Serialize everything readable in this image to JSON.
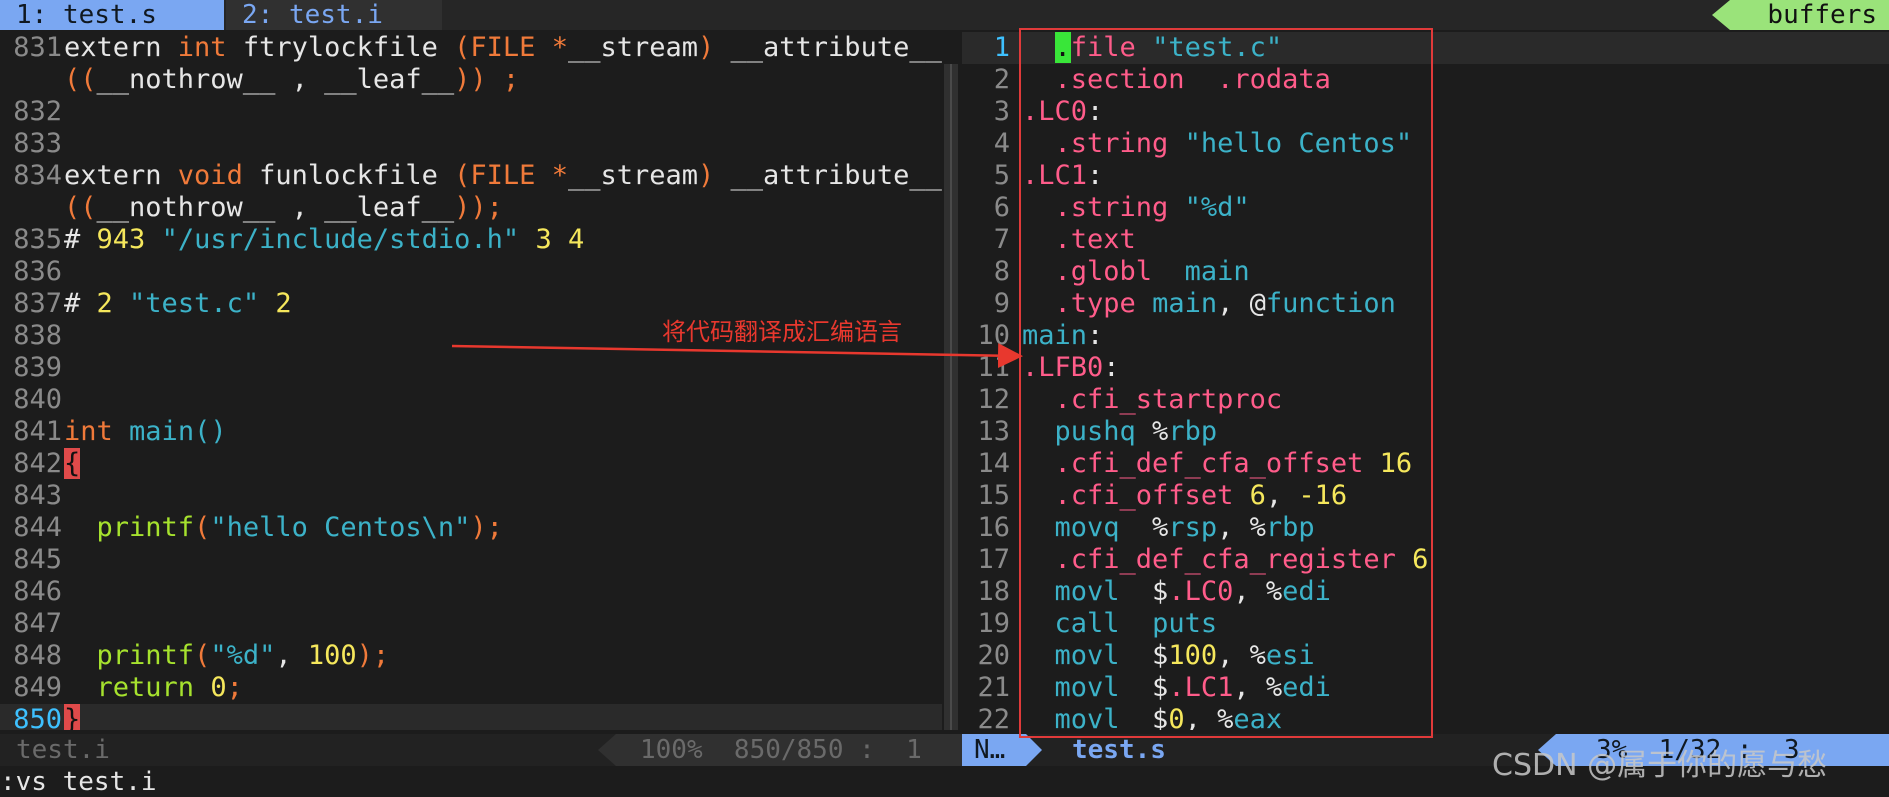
{
  "tabs": [
    {
      "label": "1: test.s"
    },
    {
      "label": "2: test.i"
    }
  ],
  "buffers_label": "buffers",
  "left_pane": {
    "lines": [
      {
        "num": "831",
        "html": "extern <span class=\"ty\">int</span> ftrylockfile <span class=\"kw\">(FILE *</span>__stream<span class=\"kw\">)</span> __attribute__"
      },
      {
        "num": "",
        "html": "<span class=\"kw\">((</span>__nothrow__ , __leaf__<span class=\"kw\">)) ;</span>"
      },
      {
        "num": "832",
        "html": ""
      },
      {
        "num": "833",
        "html": ""
      },
      {
        "num": "834",
        "html": "extern <span class=\"ty\">void</span> funlockfile <span class=\"kw\">(FILE *</span>__stream<span class=\"kw\">)</span> __attribute__"
      },
      {
        "num": "",
        "html": "<span class=\"kw\">((</span>__nothrow__ , __leaf__<span class=\"kw\">));</span>"
      },
      {
        "num": "835",
        "html": "# <span class=\"num\">943</span> <span class=\"str\">\"/usr/include/stdio.h\"</span> <span class=\"num\">3 4</span>"
      },
      {
        "num": "836",
        "html": ""
      },
      {
        "num": "837",
        "html": "# <span class=\"num\">2</span> <span class=\"str\">\"test.c\"</span> <span class=\"num\">2</span>"
      },
      {
        "num": "838",
        "html": ""
      },
      {
        "num": "839",
        "html": ""
      },
      {
        "num": "840",
        "html": ""
      },
      {
        "num": "841",
        "html": "<span class=\"ty\">int</span> <span class=\"ins\">main</span><span class=\"str\">()</span>"
      },
      {
        "num": "842",
        "html": "<span class=\"brace\">{</span>"
      },
      {
        "num": "843",
        "html": ""
      },
      {
        "num": "844",
        "html": "  <span class=\"fn\">printf</span><span class=\"kw\">(</span><span class=\"str\">\"hello Centos\\n\"</span><span class=\"kw\">);</span>"
      },
      {
        "num": "845",
        "html": ""
      },
      {
        "num": "846",
        "html": ""
      },
      {
        "num": "847",
        "html": ""
      },
      {
        "num": "848",
        "html": "  <span class=\"fn\">printf</span><span class=\"kw\">(</span><span class=\"str\">\"%d\"</span>, <span class=\"num\">100</span><span class=\"kw\">);</span>"
      },
      {
        "num": "849",
        "html": "  <span class=\"fn\">return</span> <span class=\"num\">0</span><span class=\"kw\">;</span>"
      },
      {
        "num": "850",
        "html": "<span class=\"brace\">}</span>",
        "current": true
      }
    ]
  },
  "right_pane": {
    "lines": [
      {
        "num": "1",
        "html": "  <span class=\"cursor\">.</span><span class=\"dir\">file</span> <span class=\"str\">\"test.c\"</span>",
        "current": true
      },
      {
        "num": "2",
        "html": "  <span class=\"dir\">.section</span>  <span class=\"dir\">.rodata</span>"
      },
      {
        "num": "3",
        "html": "<span class=\"lbl\">.LC0</span>:"
      },
      {
        "num": "4",
        "html": "  <span class=\"dir\">.string</span> <span class=\"str\">\"hello Centos\"</span>"
      },
      {
        "num": "5",
        "html": "<span class=\"lbl\">.LC1</span>:"
      },
      {
        "num": "6",
        "html": "  <span class=\"dir\">.string</span> <span class=\"str\">\"%<span class=\"reg\">d</span>\"</span>"
      },
      {
        "num": "7",
        "html": "  <span class=\"dir\">.text</span>"
      },
      {
        "num": "8",
        "html": "  <span class=\"dir\">.globl</span>  <span class=\"ins\">main</span>"
      },
      {
        "num": "9",
        "html": "  <span class=\"dir\">.type</span> <span class=\"ins\">main</span>, @<span class=\"ins\">function</span>"
      },
      {
        "num": "10",
        "html": "<span class=\"ins\">main</span>:"
      },
      {
        "num": "11",
        "html": "<span class=\"lbl\">.LFB0</span>:"
      },
      {
        "num": "12",
        "html": "  <span class=\"dir\">.cfi_startproc</span>"
      },
      {
        "num": "13",
        "html": "  <span class=\"ins\">pushq</span> %<span class=\"reg\">rbp</span>"
      },
      {
        "num": "14",
        "html": "  <span class=\"dir\">.cfi_def_cfa_offset</span> <span class=\"num\">16</span>"
      },
      {
        "num": "15",
        "html": "  <span class=\"dir\">.cfi_offset</span> <span class=\"num\">6</span>, <span class=\"num\">-16</span>"
      },
      {
        "num": "16",
        "html": "  <span class=\"ins\">movq</span>  %<span class=\"reg\">rsp</span>, %<span class=\"reg\">rbp</span>"
      },
      {
        "num": "17",
        "html": "  <span class=\"dir\">.cfi_def_cfa_register</span> <span class=\"num\">6</span>"
      },
      {
        "num": "18",
        "html": "  <span class=\"ins\">movl</span>  $<span class=\"lbl\">.LC0</span>, %<span class=\"reg\">edi</span>"
      },
      {
        "num": "19",
        "html": "  <span class=\"ins\">call</span>  <span class=\"ins\">puts</span>"
      },
      {
        "num": "20",
        "html": "  <span class=\"ins\">movl</span>  $<span class=\"num\">100</span>, %<span class=\"reg\">esi</span>"
      },
      {
        "num": "21",
        "html": "  <span class=\"ins\">movl</span>  $<span class=\"lbl\">.LC1</span>, %<span class=\"reg\">edi</span>"
      },
      {
        "num": "22",
        "html": "  <span class=\"ins\">movl</span>  $<span class=\"num\">0</span>, %<span class=\"reg\">eax</span>"
      }
    ]
  },
  "status": {
    "left_file": "test.i",
    "left_info": "100%  850/850 :  1",
    "mode": "N…",
    "right_file": "test.s",
    "right_info": "3%  1/32 :  3"
  },
  "cmdline": ":vs test.i",
  "annotation": "将代码翻译成汇编语言",
  "watermark": "CSDN @属于你的愿与愁",
  "colors": {
    "accent_blue": "#7aa7f2",
    "accent_green": "#9ae37a",
    "annotation_red": "#e8382e"
  }
}
